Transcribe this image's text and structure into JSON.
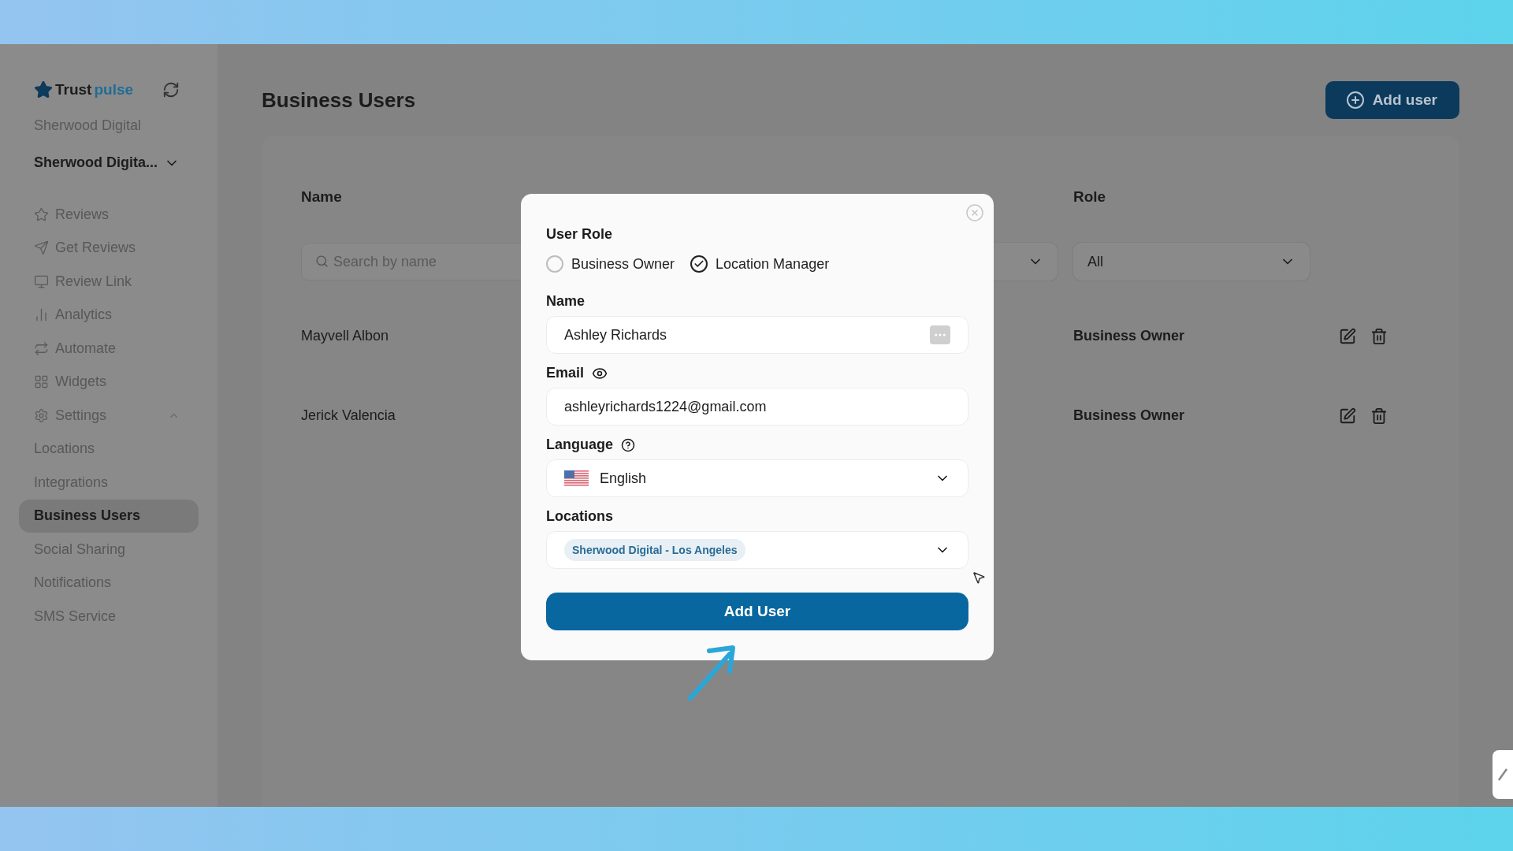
{
  "sidebar": {
    "brand": {
      "first": "Trust",
      "second": "pulse"
    },
    "account": "Sherwood Digital",
    "selector": "Sherwood Digita...",
    "items": [
      {
        "label": "Reviews",
        "selected": false
      },
      {
        "label": "Get Reviews",
        "selected": false
      },
      {
        "label": "Review Link",
        "selected": false
      },
      {
        "label": "Analytics",
        "selected": false
      },
      {
        "label": "Automate",
        "selected": false
      },
      {
        "label": "Widgets",
        "selected": false
      },
      {
        "label": "Settings",
        "selected": false,
        "expanded": true,
        "children": [
          {
            "label": "Locations",
            "selected": false
          },
          {
            "label": "Integrations",
            "selected": false
          },
          {
            "label": "Business Users",
            "selected": true
          },
          {
            "label": "Social Sharing",
            "selected": false
          },
          {
            "label": "Notifications",
            "selected": false
          },
          {
            "label": "SMS Service",
            "selected": false
          }
        ]
      }
    ]
  },
  "page": {
    "title": "Business Users",
    "add_button": "Add user"
  },
  "table": {
    "columns": [
      {
        "label": "Name"
      },
      {
        "label": "Role"
      }
    ],
    "search": {
      "placeholder": "Search by name"
    },
    "role_filter": "All",
    "rows": [
      {
        "name": "Mayvell Albon",
        "role": "Business Owner"
      },
      {
        "name": "Jerick Valencia",
        "role": "Business Owner"
      }
    ]
  },
  "modal": {
    "role_label": "User Role",
    "roles": [
      {
        "label": "Business Owner",
        "selected": false
      },
      {
        "label": "Location Manager",
        "selected": true
      }
    ],
    "name_label": "Name",
    "name_value": "Ashley Richards",
    "email_label": "Email",
    "email_value": "ashleyrichards1224@gmail.com",
    "language_label": "Language",
    "language_value": "English",
    "locations_label": "Locations",
    "location_tags": [
      "Sherwood Digital - Los Angeles"
    ],
    "submit": "Add User"
  }
}
